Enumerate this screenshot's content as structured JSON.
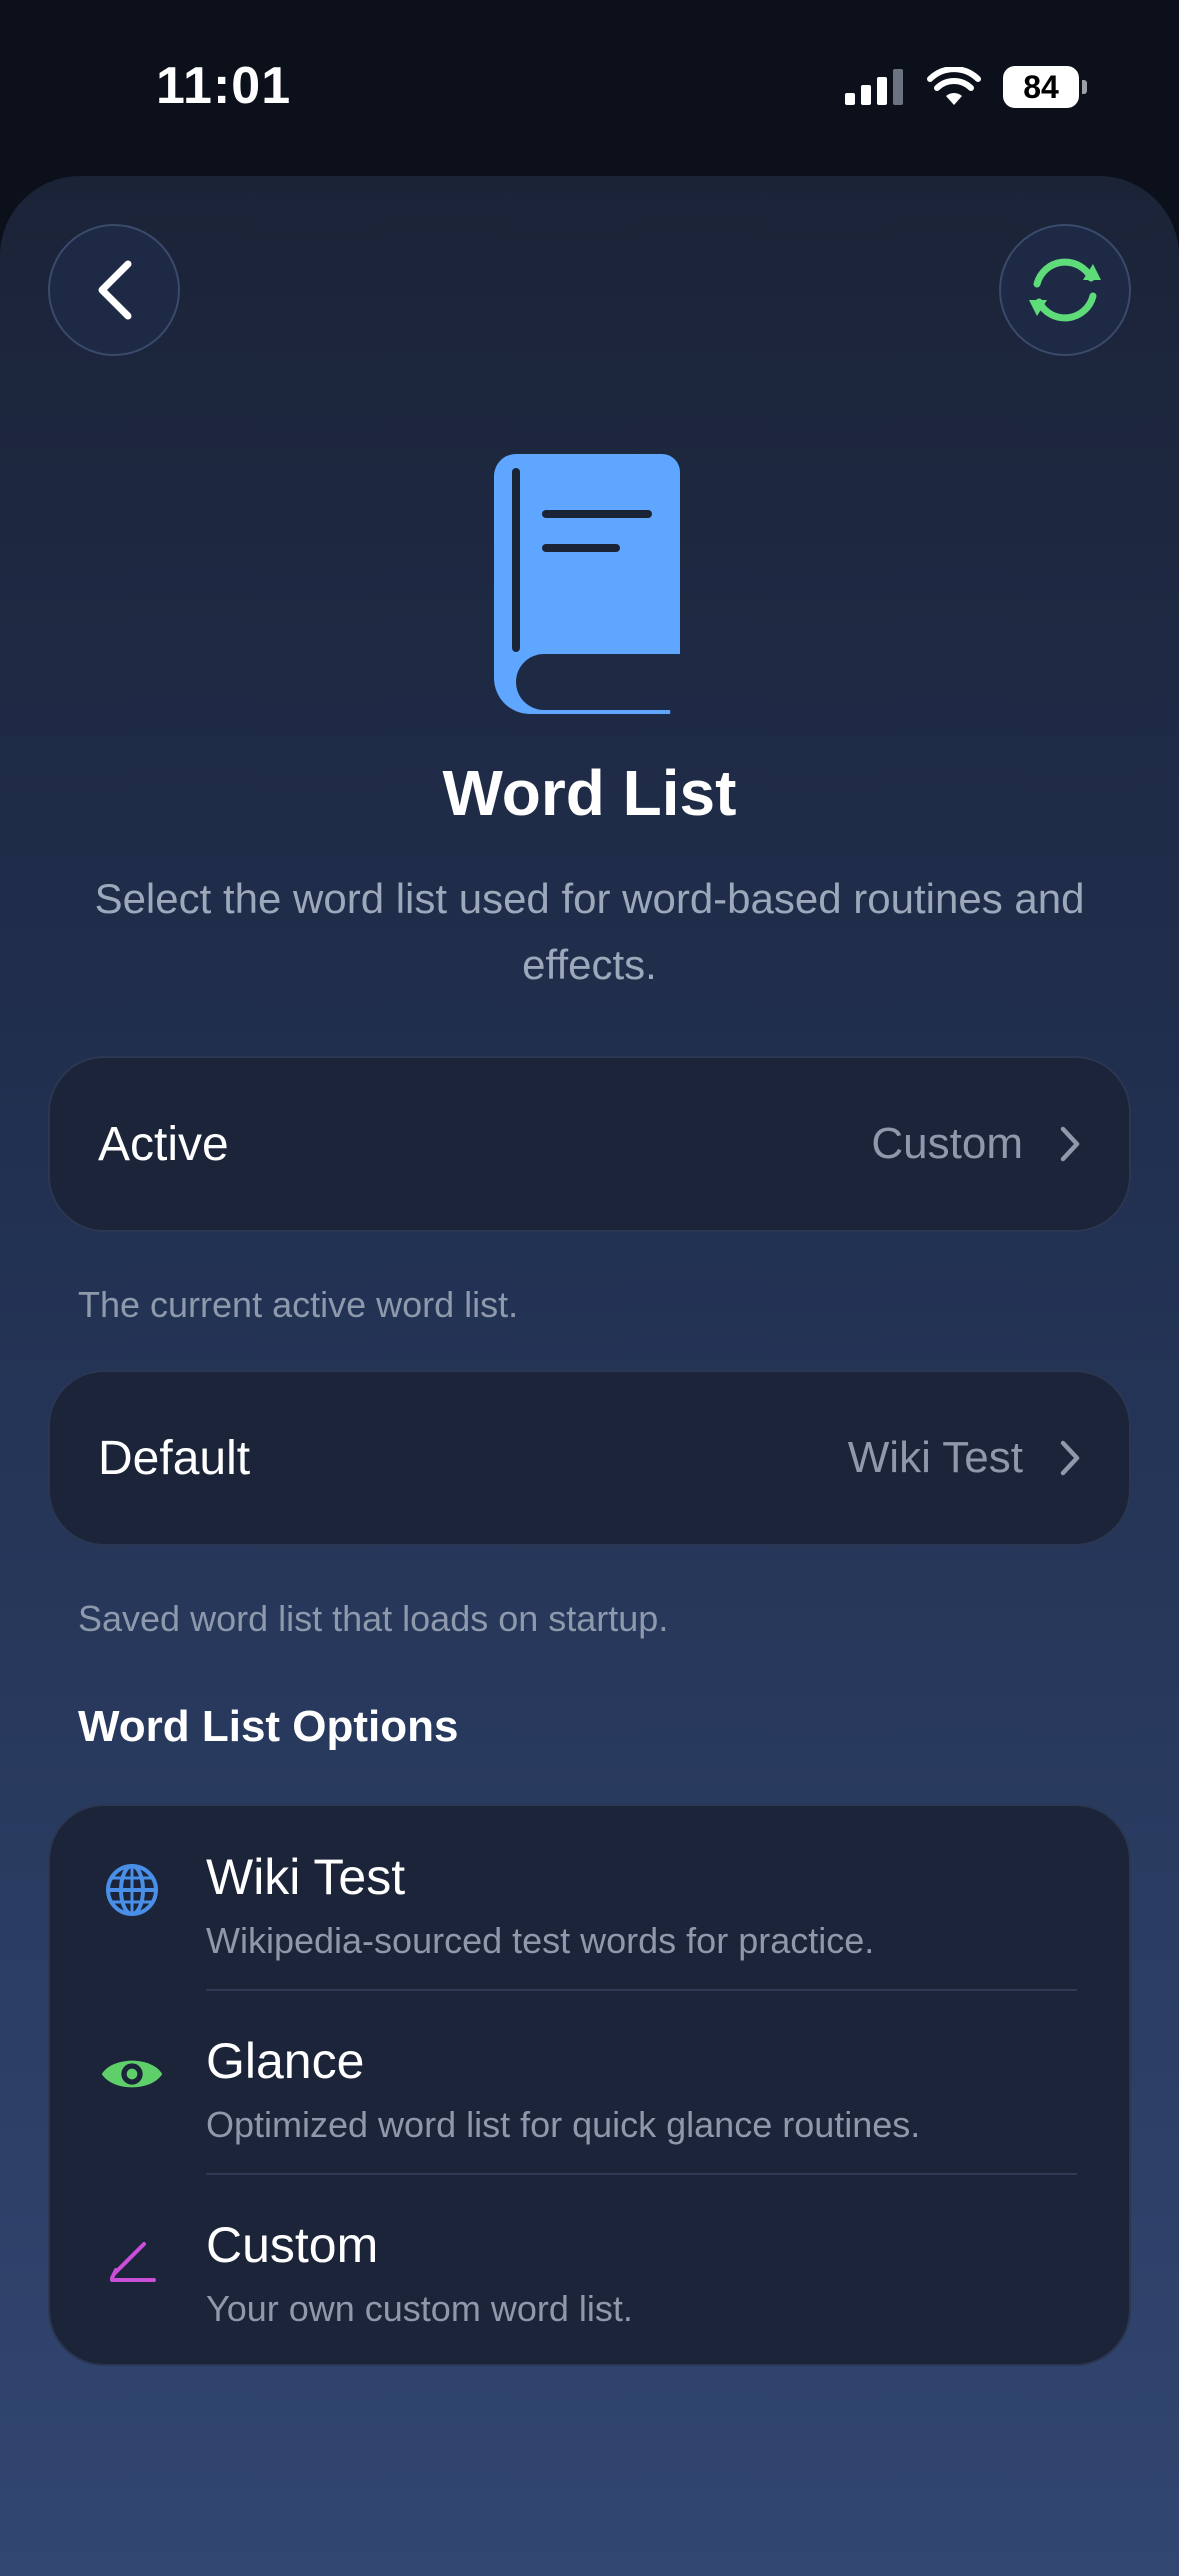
{
  "status": {
    "time": "11:01",
    "battery": "84"
  },
  "header": {
    "title": "Word List",
    "subtitle": "Select the word list used for word-based routines and effects."
  },
  "active": {
    "label": "Active",
    "value": "Custom",
    "note": "The current active word list."
  },
  "default": {
    "label": "Default",
    "value": "Wiki Test",
    "note": "Saved word list that loads on startup."
  },
  "options": {
    "header": "Word List Options",
    "items": [
      {
        "title": "Wiki Test",
        "desc": "Wikipedia-sourced test words for practice.",
        "icon": "globe-icon",
        "color": "#4a8fe7"
      },
      {
        "title": "Glance",
        "desc": "Optimized word list for quick glance routines.",
        "icon": "eye-icon",
        "color": "#5fcf6a"
      },
      {
        "title": "Custom",
        "desc": "Your own custom word list.",
        "icon": "pencil-icon",
        "color": "#c94fd8"
      }
    ]
  },
  "colors": {
    "accent_blue": "#5ea6ff",
    "accent_green": "#5fdc7a",
    "background": "#0b101b"
  }
}
